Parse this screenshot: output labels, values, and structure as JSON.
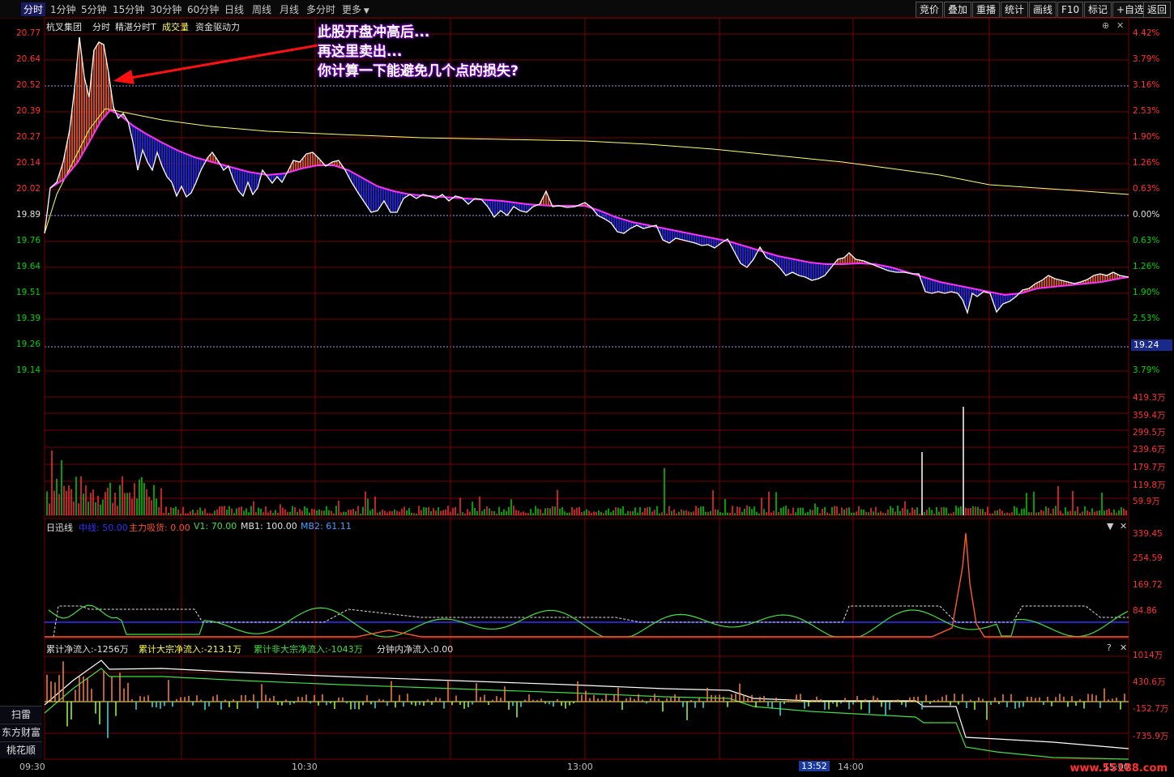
{
  "toolbar": {
    "tabs": [
      "分时",
      "1分钟",
      "5分钟",
      "15分钟",
      "30分钟",
      "60分钟",
      "日线",
      "周线",
      "月线",
      "多分时",
      "更多"
    ],
    "right_buttons": [
      "竞价",
      "叠加",
      "重播",
      "统计",
      "画线",
      "F10",
      "标记",
      "+自选",
      "返回"
    ]
  },
  "header": {
    "stock_name": "杭叉集团",
    "items": [
      "分时",
      "精湛分时T",
      "成交量",
      "资金驱动力"
    ]
  },
  "annotation": {
    "lines": [
      "此股开盘冲高后...",
      "再这里卖出...",
      "你计算一下能避免几个点的损失?"
    ]
  },
  "colors": {
    "up": "#ff3030",
    "down": "#00d000",
    "grid": "#7a0000",
    "price_line": "#ffffff",
    "avg_line": "#ffff60",
    "magenta": "#ff30ff",
    "fill_red": "#ff5a28",
    "fill_blue": "#2828ff"
  },
  "price_panel": {
    "left_ticks": [
      "20.77",
      "20.64",
      "20.52",
      "20.39",
      "20.27",
      "20.14",
      "20.02",
      "19.89",
      "19.76",
      "19.64",
      "19.51",
      "19.39",
      "19.26",
      "19.14"
    ],
    "right_ticks": [
      "4.42%",
      "3.79%",
      "3.16%",
      "2.53%",
      "1.90%",
      "1.26%",
      "0.63%",
      "0.00%",
      "0.63%",
      "1.26%",
      "1.90%",
      "2.53%",
      "3.16%",
      "3.79%"
    ],
    "current_price": "19.24"
  },
  "volume_panel": {
    "right_ticks": [
      "419.3万",
      "359.4万",
      "299.5万",
      "239.6万",
      "179.7万",
      "119.8万",
      "59.9万"
    ]
  },
  "indicator_panel": {
    "name": "日迅线",
    "legend": [
      {
        "text": "中线: 50.00",
        "color": "#3030ff"
      },
      {
        "text": "主力吸货: 0.00",
        "color": "#ff5030"
      },
      {
        "text": "V1: 70.00",
        "color": "#40e040"
      },
      {
        "text": "MB1: 100.00",
        "color": "#e0e0e0"
      },
      {
        "text": "MB2: 61.11",
        "color": "#40a0ff"
      }
    ],
    "right_ticks": [
      "339.45",
      "254.59",
      "169.72",
      "84.86"
    ]
  },
  "flow_panel": {
    "legend": [
      {
        "text": "累计净流入:-1256万",
        "color": "#e0e0e0"
      },
      {
        "text": "累计大宗净流入:-213.1万",
        "color": "#ffff40"
      },
      {
        "text": "累计非大宗净流入:-1043万",
        "color": "#40e040"
      },
      {
        "text": "分钟内净流入:0.00",
        "color": "#e0e0e0"
      }
    ],
    "right_ticks": [
      "1014万",
      "430.6万",
      "-152.7万",
      "-735.9万"
    ],
    "side_buttons": [
      "扫雷",
      "东方财富",
      "桃花顺"
    ]
  },
  "time_axis": {
    "labels": [
      "09:30",
      "10:30",
      "13:00",
      "14:00",
      "15:00"
    ],
    "cursor": "13:52"
  },
  "watermark": "www.55188.com",
  "chart_data": [
    {
      "type": "line",
      "title": "杭叉集团 分时",
      "xlabel": "",
      "ylabel": "",
      "ylim": [
        19.14,
        20.77
      ],
      "x": [
        "09:30",
        "09:34",
        "09:38",
        "09:42",
        "09:46",
        "09:50",
        "10:00",
        "10:10",
        "10:20",
        "10:30",
        "10:40",
        "10:50",
        "11:00",
        "11:10",
        "11:20",
        "11:30",
        "13:00",
        "13:10",
        "13:20",
        "13:30",
        "13:40",
        "13:50",
        "14:00",
        "14:10",
        "14:20",
        "14:30",
        "14:40",
        "14:50",
        "15:00"
      ],
      "series": [
        {
          "name": "分时",
          "values": [
            19.95,
            20.2,
            20.75,
            20.45,
            20.77,
            20.35,
            20.2,
            20.08,
            20.15,
            20.07,
            20.1,
            20.16,
            20.12,
            19.95,
            19.93,
            19.95,
            19.92,
            19.83,
            19.78,
            19.72,
            19.67,
            19.66,
            19.63,
            19.65,
            19.58,
            19.52,
            19.55,
            19.57,
            19.58
          ]
        },
        {
          "name": "均价",
          "values": [
            19.95,
            20.05,
            20.3,
            20.38,
            20.4,
            20.38,
            20.33,
            20.3,
            20.29,
            20.28,
            20.27,
            20.27,
            20.26,
            20.25,
            20.24,
            20.24,
            20.23,
            20.21,
            20.2,
            20.18,
            20.17,
            20.15,
            20.13,
            20.11,
            20.08,
            20.06,
            20.04,
            20.03,
            20.02
          ]
        }
      ]
    },
    {
      "type": "bar",
      "title": "成交量",
      "ylim": [
        0,
        419.3
      ],
      "categories": [
        "09:30",
        "09:40",
        "09:50",
        "10:00",
        "10:30",
        "11:00",
        "11:30",
        "13:00",
        "13:30",
        "14:00",
        "14:20",
        "14:30",
        "14:45",
        "15:00"
      ],
      "values": [
        300,
        280,
        250,
        160,
        90,
        60,
        40,
        70,
        110,
        90,
        150,
        360,
        120,
        100
      ]
    }
  ]
}
